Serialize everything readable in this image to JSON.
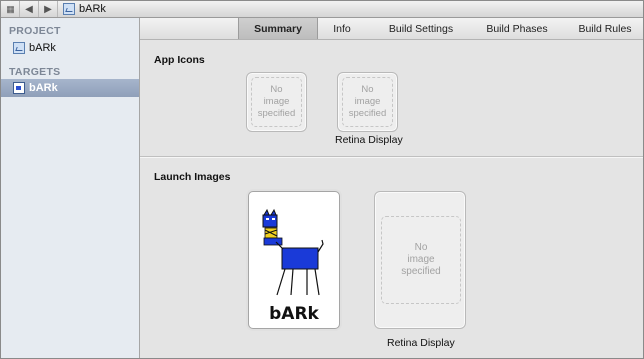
{
  "jumpbar": {
    "grid_icon": "grid-icon",
    "back_icon": "back-arrow-icon",
    "forward_icon": "forward-arrow-icon",
    "back_glyph": "◀",
    "forward_glyph": "▶",
    "grid_glyph": "▦",
    "crumb": "bARk"
  },
  "sidebar": {
    "project_heading": "PROJECT",
    "project_item": "bARk",
    "targets_heading": "TARGETS",
    "target_item": "bARk"
  },
  "tabs": [
    "Summary",
    "Info",
    "Build Settings",
    "Build Phases",
    "Build Rules"
  ],
  "app_icons": {
    "label": "App Icons",
    "placeholder_line1": "No",
    "placeholder_line2": "image",
    "placeholder_line3": "specified",
    "retina_caption": "Retina Display"
  },
  "launch_images": {
    "label": "Launch Images",
    "placeholder_line1": "No",
    "placeholder_line2": "image",
    "placeholder_line3": "specified",
    "retina_caption": "Retina Display",
    "drawing_text": "bARk"
  },
  "colors": {
    "selection": "#98a8c2",
    "dog_blue": "#1a3ad8",
    "dog_yellow": "#f0d020"
  }
}
